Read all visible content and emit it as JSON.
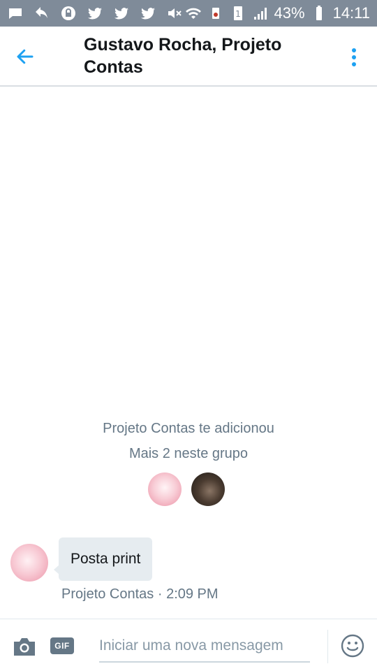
{
  "status_bar": {
    "battery": "43%",
    "time": "14:11",
    "sim_slot": "1",
    "left_icons": [
      "message-icon",
      "reply-icon",
      "lock-icon",
      "twitter-icon",
      "twitter-icon",
      "twitter-icon",
      "mute-icon"
    ],
    "right_icons": [
      "wifi-icon",
      "no-sim-icon",
      "sim-icon",
      "signal-icon",
      "battery-icon"
    ]
  },
  "header": {
    "title": "Gustavo Rocha, Projeto Contas",
    "back_icon": "arrow-left-icon",
    "menu_icon": "more-vertical-icon",
    "accent_color": "#1da1f2"
  },
  "conversation": {
    "system_added": "Projeto Contas te adicionou",
    "system_more": "Mais 2 neste grupo",
    "member_avatars": [
      "pink-floral-avatar",
      "dark-photo-avatar"
    ]
  },
  "message": {
    "text": "Posta print",
    "meta": "Projeto Contas · 2:09 PM",
    "bubble_color": "#e6ecf0"
  },
  "composer": {
    "placeholder": "Iniciar uma nova mensagem",
    "value": "",
    "gif_label": "GIF",
    "camera_icon": "camera-icon",
    "emoji_icon": "smiley-icon"
  }
}
